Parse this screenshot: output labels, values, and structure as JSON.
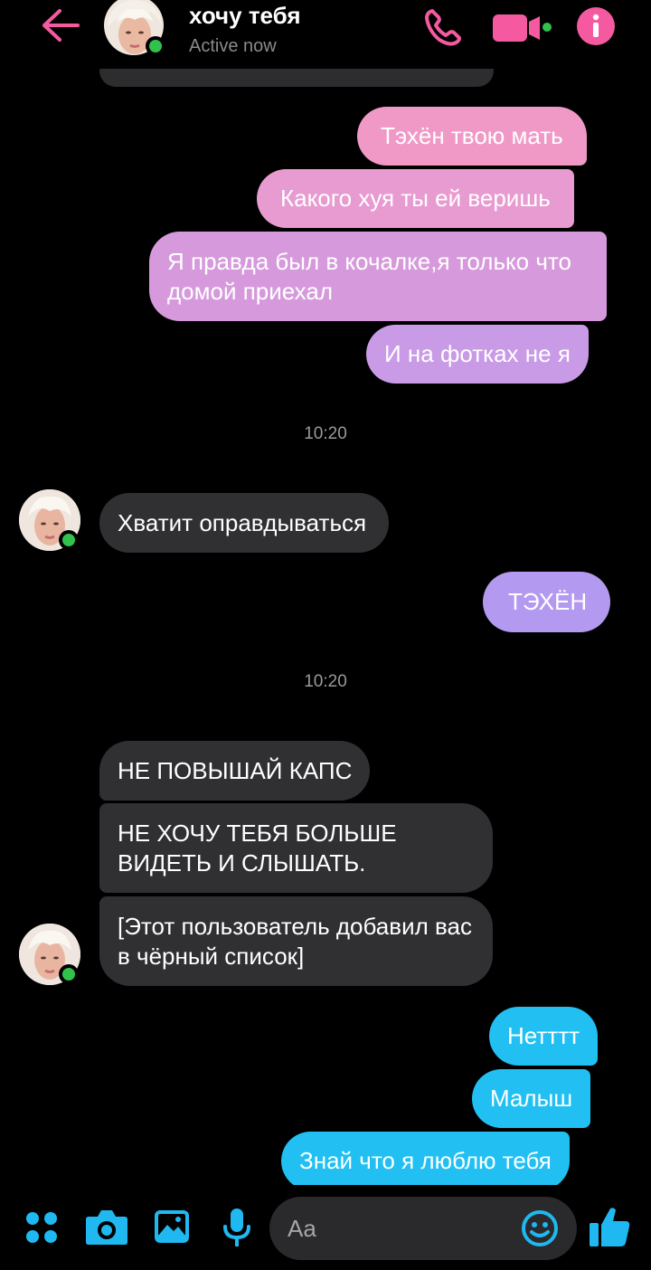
{
  "header": {
    "title": "хочу тебя",
    "status": "Active now",
    "accent": "#f55aa0"
  },
  "messages": [
    {
      "text": "Тэхён твою мать",
      "from": "me",
      "style": "gradient"
    },
    {
      "text": "Какого хуя ты ей веришь",
      "from": "me",
      "style": "gradient"
    },
    {
      "text": "Я правда был в кочалке,я только что домой приехал",
      "from": "me",
      "style": "gradient"
    },
    {
      "text": "И на фотках не я",
      "from": "me",
      "style": "gradient"
    },
    {
      "timestamp": "10:20"
    },
    {
      "text": "Хватит оправдываться",
      "from": "them"
    },
    {
      "text": "ТЭХЁН",
      "from": "me",
      "style": "gradient"
    },
    {
      "timestamp": "10:20"
    },
    {
      "text": "НЕ ПОВЫШАЙ КАПС",
      "from": "them"
    },
    {
      "text": "НЕ ХОЧУ ТЕБЯ БОЛЬШЕ ВИДЕТЬ И СЛЫШАТЬ.",
      "from": "them"
    },
    {
      "text": "[Этот пользователь добавил вас в чёрный список]",
      "from": "them"
    },
    {
      "text": "Нетттт",
      "from": "me",
      "style": "blue"
    },
    {
      "text": "Малыш",
      "from": "me",
      "style": "blue"
    },
    {
      "text": "Знай что я люблю тебя",
      "from": "me",
      "style": "blue"
    }
  ],
  "composer": {
    "placeholder": "Aa",
    "accent": "#1fb8f0"
  },
  "icons": [
    "back-arrow-icon",
    "phone-icon",
    "video-camera-icon",
    "info-icon",
    "apps-grid-icon",
    "camera-icon",
    "image-icon",
    "microphone-icon",
    "emoji-icon",
    "thumbs-up-icon"
  ]
}
